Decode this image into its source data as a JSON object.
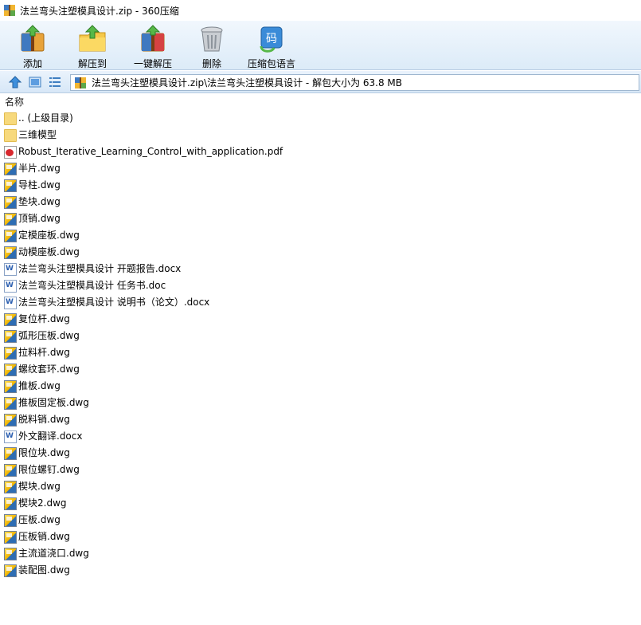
{
  "window": {
    "title": "法兰弯头注塑模具设计.zip - 360压缩"
  },
  "toolbar": {
    "buttons": [
      {
        "label": "添加",
        "icon": "add-archive-icon"
      },
      {
        "label": "解压到",
        "icon": "extract-to-icon"
      },
      {
        "label": "一键解压",
        "icon": "one-click-extract-icon"
      },
      {
        "label": "删除",
        "icon": "delete-trash-icon"
      },
      {
        "label": "压缩包语言",
        "icon": "archive-language-icon"
      }
    ]
  },
  "addressbar": {
    "path": "法兰弯头注塑模具设计.zip\\法兰弯头注塑模具设计 - 解包大小为 63.8 MB"
  },
  "list": {
    "column_name": "名称",
    "items": [
      {
        "name": ".. (上级目录)",
        "type": "folder"
      },
      {
        "name": "三维模型",
        "type": "folder"
      },
      {
        "name": "Robust_Iterative_Learning_Control_with_application.pdf",
        "type": "pdf"
      },
      {
        "name": "半片.dwg",
        "type": "dwg"
      },
      {
        "name": "导柱.dwg",
        "type": "dwg"
      },
      {
        "name": "垫块.dwg",
        "type": "dwg"
      },
      {
        "name": "顶销.dwg",
        "type": "dwg"
      },
      {
        "name": "定模座板.dwg",
        "type": "dwg"
      },
      {
        "name": "动模座板.dwg",
        "type": "dwg"
      },
      {
        "name": "法兰弯头注塑模具设计 开题报告.docx",
        "type": "doc"
      },
      {
        "name": "法兰弯头注塑模具设计 任务书.doc",
        "type": "doc"
      },
      {
        "name": "法兰弯头注塑模具设计 说明书（论文）.docx",
        "type": "doc"
      },
      {
        "name": "复位杆.dwg",
        "type": "dwg"
      },
      {
        "name": "弧形压板.dwg",
        "type": "dwg"
      },
      {
        "name": "拉料杆.dwg",
        "type": "dwg"
      },
      {
        "name": "螺纹套环.dwg",
        "type": "dwg"
      },
      {
        "name": "推板.dwg",
        "type": "dwg"
      },
      {
        "name": "推板固定板.dwg",
        "type": "dwg"
      },
      {
        "name": "脱料销.dwg",
        "type": "dwg"
      },
      {
        "name": "外文翻译.docx",
        "type": "doc"
      },
      {
        "name": "限位块.dwg",
        "type": "dwg"
      },
      {
        "name": "限位螺钉.dwg",
        "type": "dwg"
      },
      {
        "name": "楔块.dwg",
        "type": "dwg"
      },
      {
        "name": "楔块2.dwg",
        "type": "dwg"
      },
      {
        "name": "压板.dwg",
        "type": "dwg"
      },
      {
        "name": "压板销.dwg",
        "type": "dwg"
      },
      {
        "name": "主流道浇口.dwg",
        "type": "dwg"
      },
      {
        "name": "装配图.dwg",
        "type": "dwg"
      }
    ]
  }
}
